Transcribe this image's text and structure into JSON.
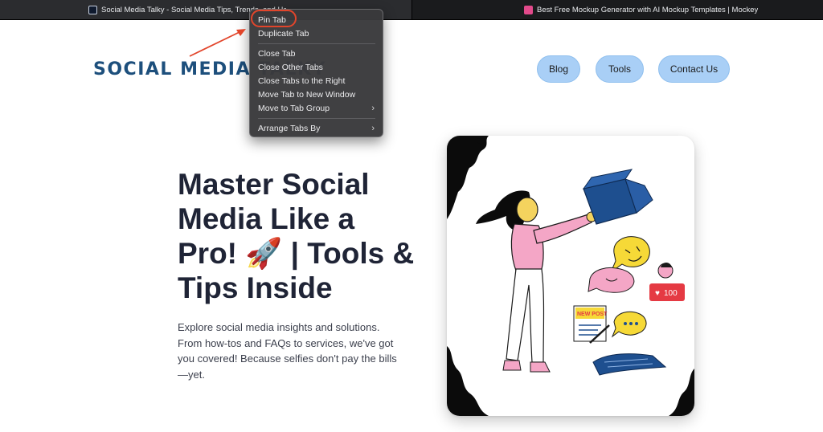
{
  "browser": {
    "tabs": [
      {
        "title": "Social Media Talky - Social Media Tips, Trends, and How..."
      },
      {
        "title": "Best Free Mockup Generator with AI Mockup Templates | Mockey"
      }
    ]
  },
  "context_menu": {
    "items": [
      {
        "label": "Pin Tab"
      },
      {
        "label": "Duplicate Tab"
      },
      {
        "label": "Close Tab"
      },
      {
        "label": "Close Other Tabs"
      },
      {
        "label": "Close Tabs to the Right"
      },
      {
        "label": "Move Tab to New Window"
      },
      {
        "label": "Move to Tab Group",
        "arrow": "›"
      },
      {
        "label": "Arrange Tabs By",
        "arrow": "›"
      }
    ],
    "highlighted_item": "Pin Tab"
  },
  "header": {
    "logo": "SOCIAL MEDIA TALKY",
    "nav": [
      {
        "label": "Blog"
      },
      {
        "label": "Tools"
      },
      {
        "label": "Contact Us"
      }
    ]
  },
  "hero": {
    "title": "Master Social Media Like a Pro! 🚀 | Tools & Tips Inside",
    "description": "Explore social media insights and solutions. From how-tos and FAQs to services, we've got you covered! Because selfies don't pay the bills—yet."
  },
  "illustration": {
    "badge_text": "NEW POST",
    "like_count": "100",
    "heart_symbol": "♥"
  },
  "colors": {
    "logo": "#1d4f7c",
    "nav_button": "#a9cff6",
    "title": "#1f2436",
    "annotation": "#e2452b"
  },
  "icons": {
    "menu_submenu": "chevron-right-icon",
    "annotation": "red-arrow-icon"
  }
}
